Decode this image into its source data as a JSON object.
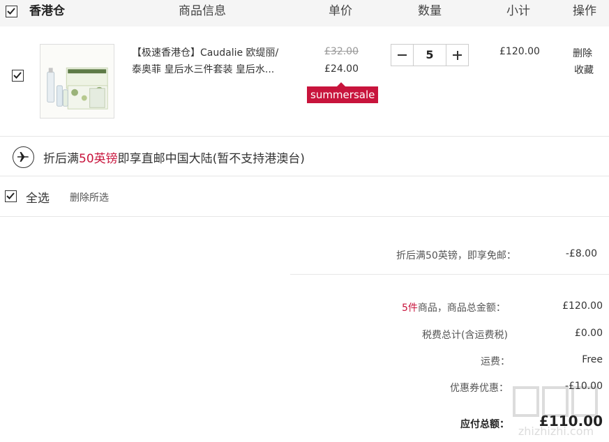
{
  "header": {
    "store": "香港仓",
    "col_info": "商品信息",
    "col_price": "单价",
    "col_qty": "数量",
    "col_subtotal": "小计",
    "col_op": "操作"
  },
  "item": {
    "title_line1": "【极速香港仓】Caudalie 欧缇丽/",
    "title_line2": "泰奥菲 皇后水三件套装 皇后水...",
    "price_original": "£32.00",
    "price_current": "£24.00",
    "promo_tag": "summersale",
    "quantity": "5",
    "subtotal": "£120.00",
    "op_delete": "删除",
    "op_favorite": "收藏"
  },
  "shipping": {
    "prefix": "折后满",
    "amount": "50英镑",
    "suffix": "即享直邮中国大陆(暂不支持港澳台)"
  },
  "selection": {
    "select_all": "全选",
    "delete_selected": "删除所选"
  },
  "summary": {
    "free_ship_label": "折后满50英镑，即享免邮：",
    "free_ship_value": "-£8.00",
    "count": "5件",
    "goods_total_label": "商品，商品总金额：",
    "goods_total_value": "£120.00",
    "tax_label": "税费总计(含运费税)",
    "tax_value": "£0.00",
    "shipping_label": "运费：",
    "shipping_value": "Free",
    "coupon_label": "优惠券优惠：",
    "coupon_value": "-£10.00",
    "total_label": "应付总额：",
    "total_value": "£110.00"
  },
  "watermark_text": "zhizhizhi.com",
  "colors": {
    "accent_red": "#c8143c",
    "header_bg": "#f5f5f5"
  }
}
